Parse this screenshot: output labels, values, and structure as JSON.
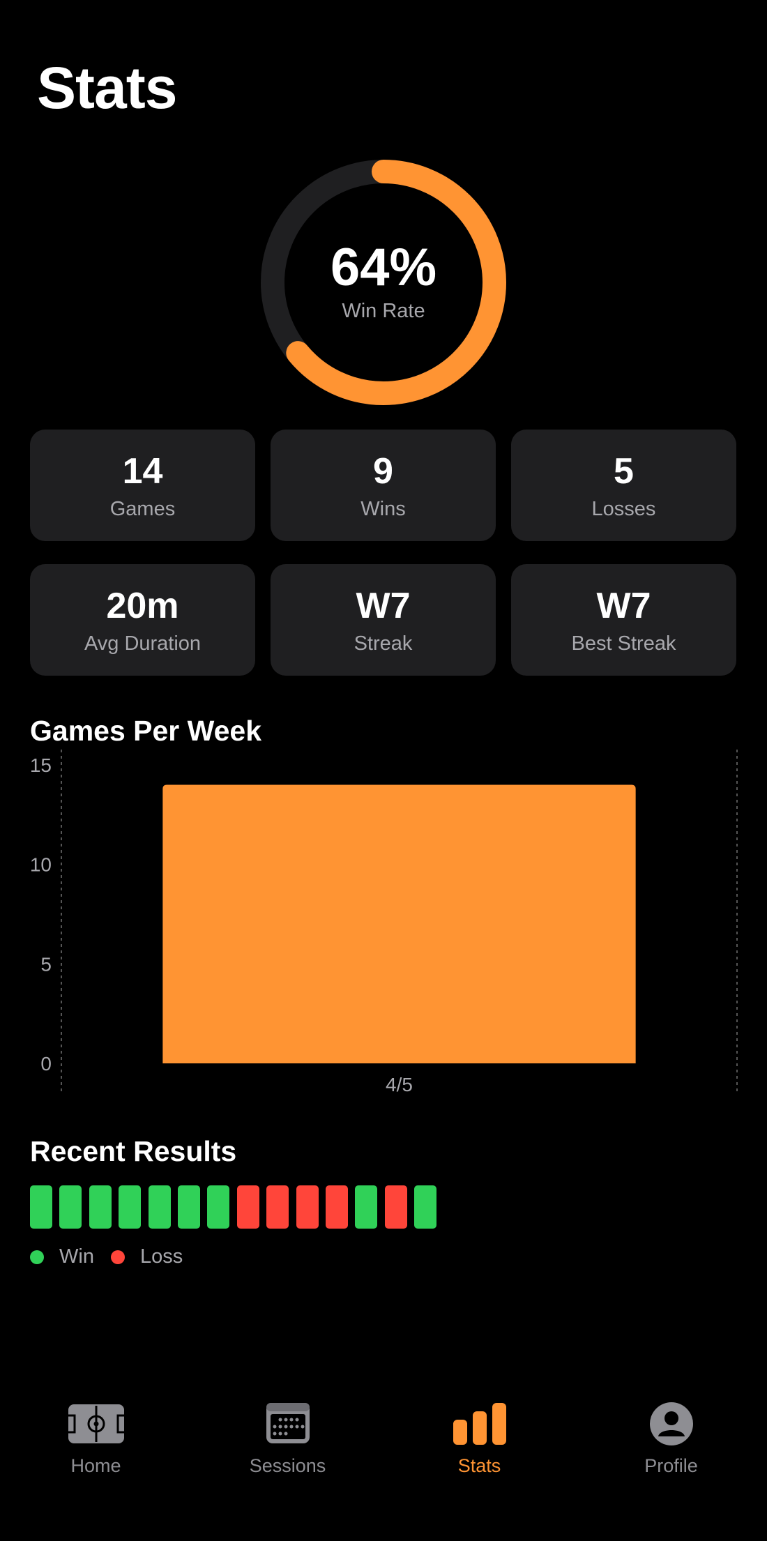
{
  "header": {
    "title": "Stats"
  },
  "win_rate": {
    "percent_label": "64%",
    "label": "Win Rate",
    "fraction": 0.64
  },
  "stats": [
    {
      "value": "14",
      "label": "Games"
    },
    {
      "value": "9",
      "label": "Wins"
    },
    {
      "value": "5",
      "label": "Losses"
    },
    {
      "value": "20m",
      "label": "Avg Duration"
    },
    {
      "value": "W7",
      "label": "Streak"
    },
    {
      "value": "W7",
      "label": "Best Streak"
    }
  ],
  "chart_section": {
    "title": "Games Per Week"
  },
  "chart_data": {
    "type": "bar",
    "categories": [
      "4/5"
    ],
    "values": [
      14
    ],
    "title": "Games Per Week",
    "xlabel": "",
    "ylabel": "",
    "ylim": [
      0,
      15
    ],
    "yticks": [
      0,
      5,
      10,
      15
    ],
    "color": "#ff9433"
  },
  "recent_results": {
    "title": "Recent Results",
    "results": [
      "W",
      "W",
      "W",
      "W",
      "W",
      "W",
      "W",
      "L",
      "L",
      "L",
      "L",
      "W",
      "L",
      "W"
    ],
    "legend": [
      {
        "key": "W",
        "label": "Win"
      },
      {
        "key": "L",
        "label": "Loss"
      }
    ]
  },
  "tabs": [
    {
      "id": "home",
      "label": "Home",
      "icon": "field-icon",
      "active": false
    },
    {
      "id": "sessions",
      "label": "Sessions",
      "icon": "calendar-icon",
      "active": false
    },
    {
      "id": "stats",
      "label": "Stats",
      "icon": "bar-chart-icon",
      "active": true
    },
    {
      "id": "profile",
      "label": "Profile",
      "icon": "person-icon",
      "active": false
    }
  ],
  "colors": {
    "accent": "#ff9433",
    "win": "#30d158",
    "loss": "#ff453a",
    "card": "#1f1f21",
    "inactive": "#8e8e93"
  }
}
